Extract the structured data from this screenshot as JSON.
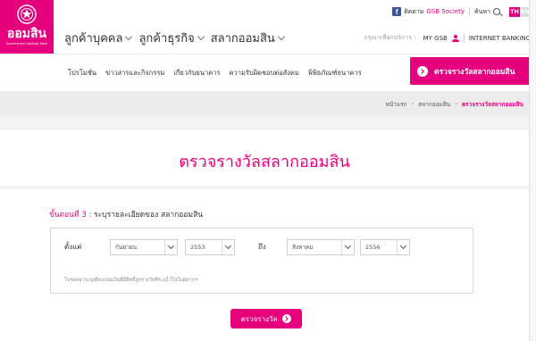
{
  "brand": {
    "name": "ออมสิน",
    "tagline": "Government Savings Bank",
    "color": "#e6007e"
  },
  "topbar": {
    "facebook_icon": "facebook-icon",
    "follow_label": "ติดตาม",
    "society_label": "GSB Society",
    "search_label": "ค้นหา",
    "lang_th": "TH",
    "lang_en": "EN"
  },
  "main_nav": {
    "items": [
      {
        "label": "ลูกค้าบุคคล"
      },
      {
        "label": "ลูกค้าธุรกิจ"
      },
      {
        "label": "สลากออมสิน"
      }
    ]
  },
  "services": {
    "label": "กรุณาเลือกบริการ :",
    "mygsb": "MY GSB",
    "internet_banking": "INTERNET BANKING"
  },
  "sub_nav": {
    "items": [
      {
        "label": "โปรโมชั่น"
      },
      {
        "label": "ข่าวสารและกิจกรรม"
      },
      {
        "label": "เกี่ยวกับธนาคาร"
      },
      {
        "label": "ความรับผิดชอบต่อสังคม"
      },
      {
        "label": "พิพิธภัณฑ์ธนาคาร"
      }
    ],
    "check_button": "ตรวจรางวัลสลากออมสิน"
  },
  "breadcrumb": {
    "items": [
      "หน้าแรก",
      "สลากออมสิน",
      "ตรวจรางวัลสลากออมสิน"
    ]
  },
  "page": {
    "title": "ตรวจรางวัลสลากออมสิน"
  },
  "form": {
    "step_label": "ขั้นตอนที่ 3",
    "step_text": ": ระบุรายละเอียดของ สลากออมสิน",
    "from_label": "ตั้งแต่",
    "to_label": "ถึง",
    "from_month": "กันยายน",
    "from_year": "2553",
    "to_month": "สิงหาคม",
    "to_year": "2556",
    "note": "โปรดอย่าระบุเดือนก่อนวันที่มีสิทธิ์ถูกรางวัลที่ระบุไว้ในใบสลากฯ",
    "submit_label": "ตรวจรางวัล"
  }
}
